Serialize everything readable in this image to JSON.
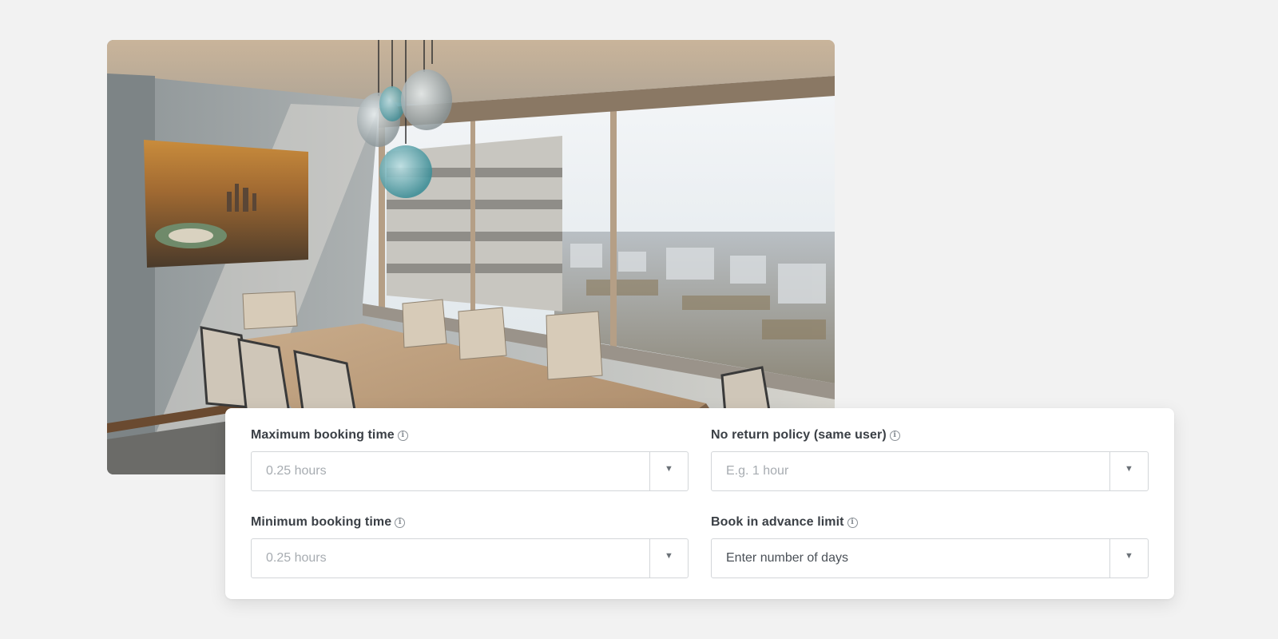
{
  "photo": {
    "name": "conference-room-photo"
  },
  "form": {
    "fields": [
      {
        "label": "Maximum booking time",
        "value": "0.25 hours",
        "placeholder": true,
        "arrow": "▼"
      },
      {
        "label": "No return policy (same user)",
        "value": "E.g. 1 hour",
        "placeholder": true,
        "arrow": "▼"
      },
      {
        "label": "Minimum booking time",
        "value": "0.25 hours",
        "placeholder": true,
        "arrow": "▼"
      },
      {
        "label": "Book in advance limit",
        "value": "Enter number of days",
        "placeholder": false,
        "arrow": "▼"
      }
    ],
    "info_glyph": "i"
  },
  "colors": {
    "background": "#f2f2f2",
    "card": "#ffffff",
    "label": "#3a3f45",
    "placeholder": "#a7acb1",
    "border": "#d3d6d9"
  }
}
